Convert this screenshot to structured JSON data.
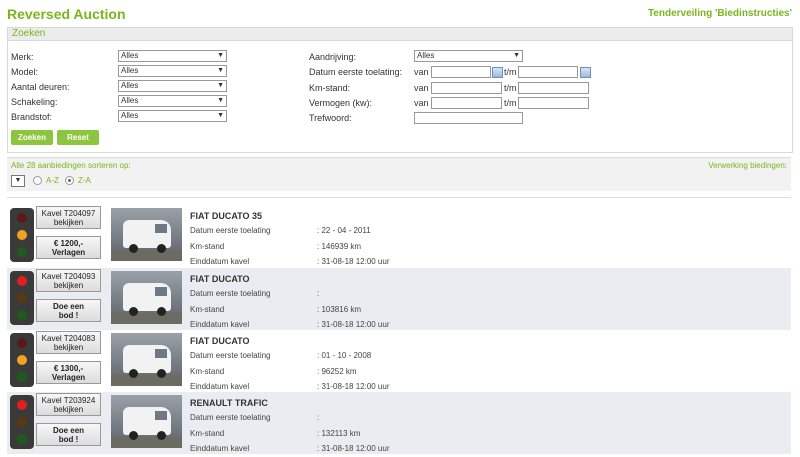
{
  "header": {
    "title": "Reversed Auction",
    "link": "Tenderveiling 'Biedinstructies'"
  },
  "search": {
    "title": "Zoeken",
    "left_fields": [
      {
        "label": "Merk:",
        "value": "Alles"
      },
      {
        "label": "Model:",
        "value": "Alles"
      },
      {
        "label": "Aantal deuren:",
        "value": "Alles"
      },
      {
        "label": "Schakeling:",
        "value": "Alles"
      },
      {
        "label": "Brandstof:",
        "value": "Alles"
      }
    ],
    "aandrijving": {
      "label": "Aandrijving:",
      "value": "Alles"
    },
    "datum": {
      "label": "Datum eerste toelating:",
      "van": "van",
      "tm": "t/m"
    },
    "km": {
      "label": "Km-stand:",
      "van": "van",
      "tm": "t/m"
    },
    "vermogen": {
      "label": "Vermogen (kw):",
      "van": "van",
      "tm": "t/m"
    },
    "trefwoord": {
      "label": "Trefwoord:"
    },
    "zoeken_label": "Zoeken",
    "reset_label": "Reset"
  },
  "sort": {
    "label": "Alle 28 aanbiedingen sorteren op:",
    "verwerking": "Verwerking biedingen:",
    "az": "A-Z",
    "za": "Z-A",
    "selected": "Z-A"
  },
  "labels": {
    "datum": "Datum eerste toelating",
    "km": "Km-stand",
    "einddatum": "Einddatum kavel"
  },
  "lots": [
    {
      "kavel": "Kavel T204097",
      "bekijken": "bekijken",
      "price": "€ 1200,-",
      "action": "Verlagen",
      "title": "FIAT DUCATO 35",
      "datum": ": 22 - 04 - 2011",
      "km": ": 146939 km",
      "eind": ": 31-08-18 12:00 uur",
      "light": "orange"
    },
    {
      "kavel": "Kavel T204093",
      "bekijken": "bekijken",
      "price": "Doe een",
      "action": "bod !",
      "title": "FIAT DUCATO",
      "datum": ":",
      "km": ": 103816 km",
      "eind": ": 31-08-18 12:00 uur",
      "light": "red"
    },
    {
      "kavel": "Kavel T204083",
      "bekijken": "bekijken",
      "price": "€ 1300,-",
      "action": "Verlagen",
      "title": "FIAT DUCATO",
      "datum": ": 01 - 10 - 2008",
      "km": ": 96252 km",
      "eind": ": 31-08-18 12:00 uur",
      "light": "orange"
    },
    {
      "kavel": "Kavel T203924",
      "bekijken": "bekijken",
      "price": "Doe een",
      "action": "bod !",
      "title": "RENAULT TRAFIC",
      "datum": ":",
      "km": ": 132113 km",
      "eind": ": 31-08-18 12:00 uur",
      "light": "red"
    }
  ]
}
